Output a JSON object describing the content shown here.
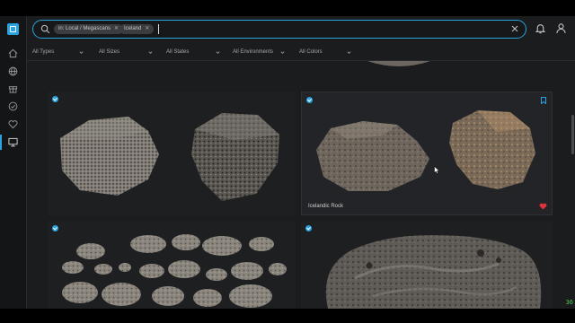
{
  "search": {
    "chips": [
      {
        "label": "in: Local / Megascans"
      },
      {
        "label": "Iceland"
      }
    ],
    "clear_icon": "close-icon"
  },
  "header": {
    "notifications_icon": "bell-icon",
    "account_icon": "user-icon"
  },
  "sidebar": {
    "items": [
      {
        "name": "home",
        "icon": "home-icon"
      },
      {
        "name": "globe",
        "icon": "globe-icon"
      },
      {
        "name": "gift",
        "icon": "gift-icon"
      },
      {
        "name": "check",
        "icon": "check-circle-icon"
      },
      {
        "name": "favorites",
        "icon": "heart-icon"
      },
      {
        "name": "local",
        "icon": "monitor-icon",
        "active": true
      }
    ]
  },
  "filters": [
    {
      "label": "All Types"
    },
    {
      "label": "All Sizes"
    },
    {
      "label": "All States"
    },
    {
      "label": "All Environments"
    },
    {
      "label": "All Colors"
    }
  ],
  "cards": [
    {
      "label": "",
      "selected": true,
      "favorited": false
    },
    {
      "label": "Icelandic Rock",
      "selected": true,
      "favorited": true,
      "highlighted": true
    },
    {
      "label": "",
      "selected": true,
      "favorited": false
    },
    {
      "label": "",
      "selected": true,
      "favorited": false
    }
  ],
  "overlay": {
    "fps": "36"
  },
  "colors": {
    "accent": "#2aa3e0",
    "favorite": "#e0323a",
    "background": "#1b1c1e"
  }
}
